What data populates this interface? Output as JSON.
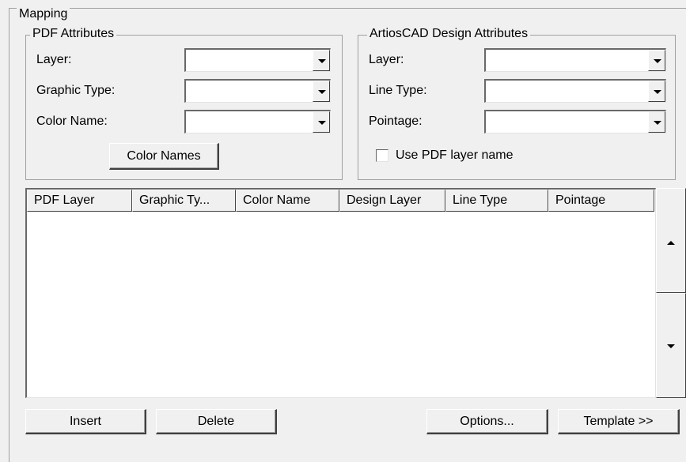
{
  "mapping": {
    "title": "Mapping",
    "pdf_attributes": {
      "title": "PDF Attributes",
      "layer_label": "Layer:",
      "graphic_type_label": "Graphic Type:",
      "color_name_label": "Color Name:",
      "layer_value": "",
      "graphic_type_value": "",
      "color_name_value": "",
      "color_names_button": "Color Names"
    },
    "design_attributes": {
      "title": "ArtiosCAD Design Attributes",
      "layer_label": "Layer:",
      "line_type_label": "Line Type:",
      "pointage_label": "Pointage:",
      "layer_value": "",
      "line_type_value": "",
      "pointage_value": "",
      "use_pdf_layer_name_label": "Use PDF layer name",
      "use_pdf_layer_name_checked": false
    },
    "list": {
      "columns": [
        "PDF Layer",
        "Graphic Ty...",
        "Color Name",
        "Design Layer",
        "Line Type",
        "Pointage"
      ],
      "rows": []
    },
    "buttons": {
      "insert": "Insert",
      "delete": "Delete",
      "options": "Options...",
      "template": "Template >>"
    }
  },
  "colors": {
    "dialog_background": "#f0f0f0",
    "field_background": "#ffffff",
    "group_border": "#a0a0a0"
  }
}
